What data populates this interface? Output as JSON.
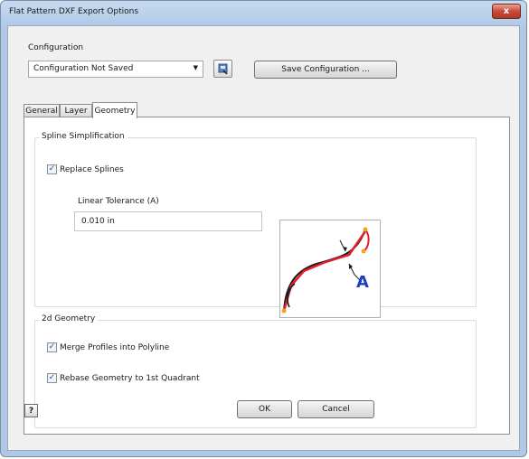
{
  "window": {
    "title": "Flat Pattern DXF Export Options",
    "close_glyph": "x"
  },
  "configuration": {
    "label": "Configuration",
    "selected": "Configuration Not Saved",
    "save_button": "Save Configuration ..."
  },
  "tabs": [
    {
      "label": "General"
    },
    {
      "label": "Layer"
    },
    {
      "label": "Geometry",
      "active": true
    }
  ],
  "spline_group": {
    "title": "Spline Simplification",
    "replace_splines": {
      "label": "Replace Splines",
      "checked": true
    },
    "tolerance_label": "Linear Tolerance (A)",
    "tolerance_value": "0.010 in",
    "diagram_label": "A"
  },
  "geometry_group": {
    "title": "2d Geometry",
    "merge_profiles": {
      "label": "Merge Profiles into Polyline",
      "checked": true
    },
    "rebase_geometry": {
      "label": "Rebase Geometry to 1st Quadrant",
      "checked": true
    }
  },
  "footer": {
    "help_glyph": "?",
    "ok": "OK",
    "cancel": "Cancel"
  },
  "colors": {
    "accent_red": "#e3202a",
    "accent_orange": "#f5a21b",
    "label_blue": "#1c3fbf"
  }
}
